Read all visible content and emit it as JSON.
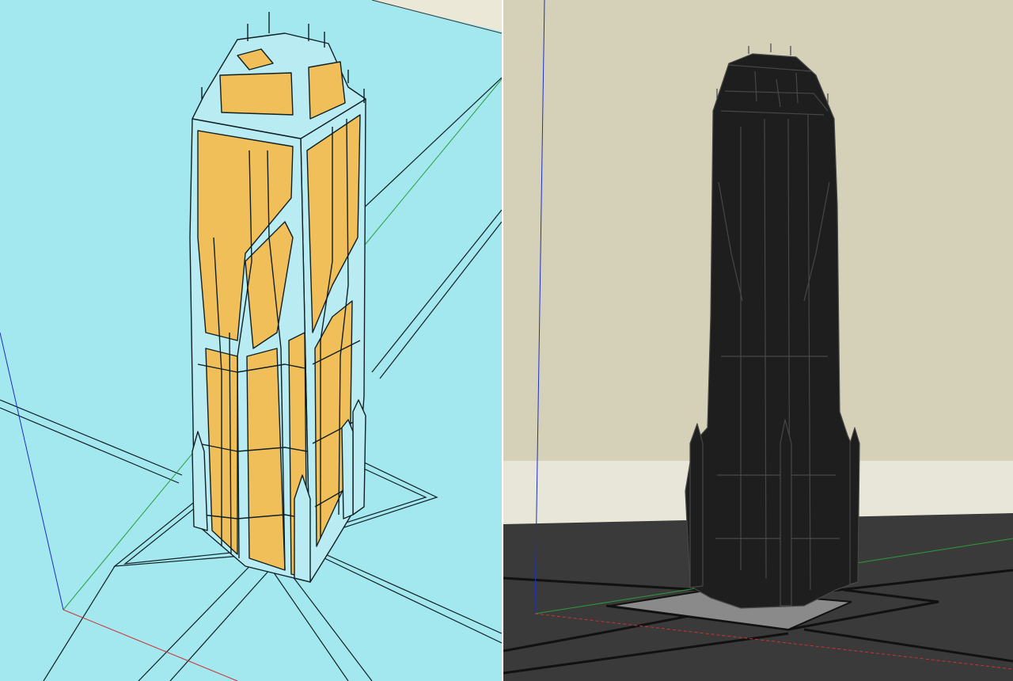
{
  "colors": {
    "left_background": "#a3e7ef",
    "left_far_plane": "#ece8d8",
    "tower_glass": "#f1bf5a",
    "tower_frame": "#b8ecf2",
    "outline": "#0f1f24",
    "axis_red": "#c33",
    "axis_green": "#2a9d3a",
    "axis_blue": "#1d2fbf",
    "right_wall": "#d5d1b8",
    "right_baseboard": "#e7e6d9",
    "right_floor": "#3a3a3a",
    "tower_dark": "#1e1e1e",
    "tower_dark_edge": "#474747",
    "footprint_grey": "#8a8a8a"
  },
  "viewports": [
    {
      "name": "left-viewport",
      "style": "shaded-with-edges",
      "subject": "tower-model"
    },
    {
      "name": "right-viewport",
      "style": "dark-material",
      "subject": "tower-model"
    }
  ]
}
